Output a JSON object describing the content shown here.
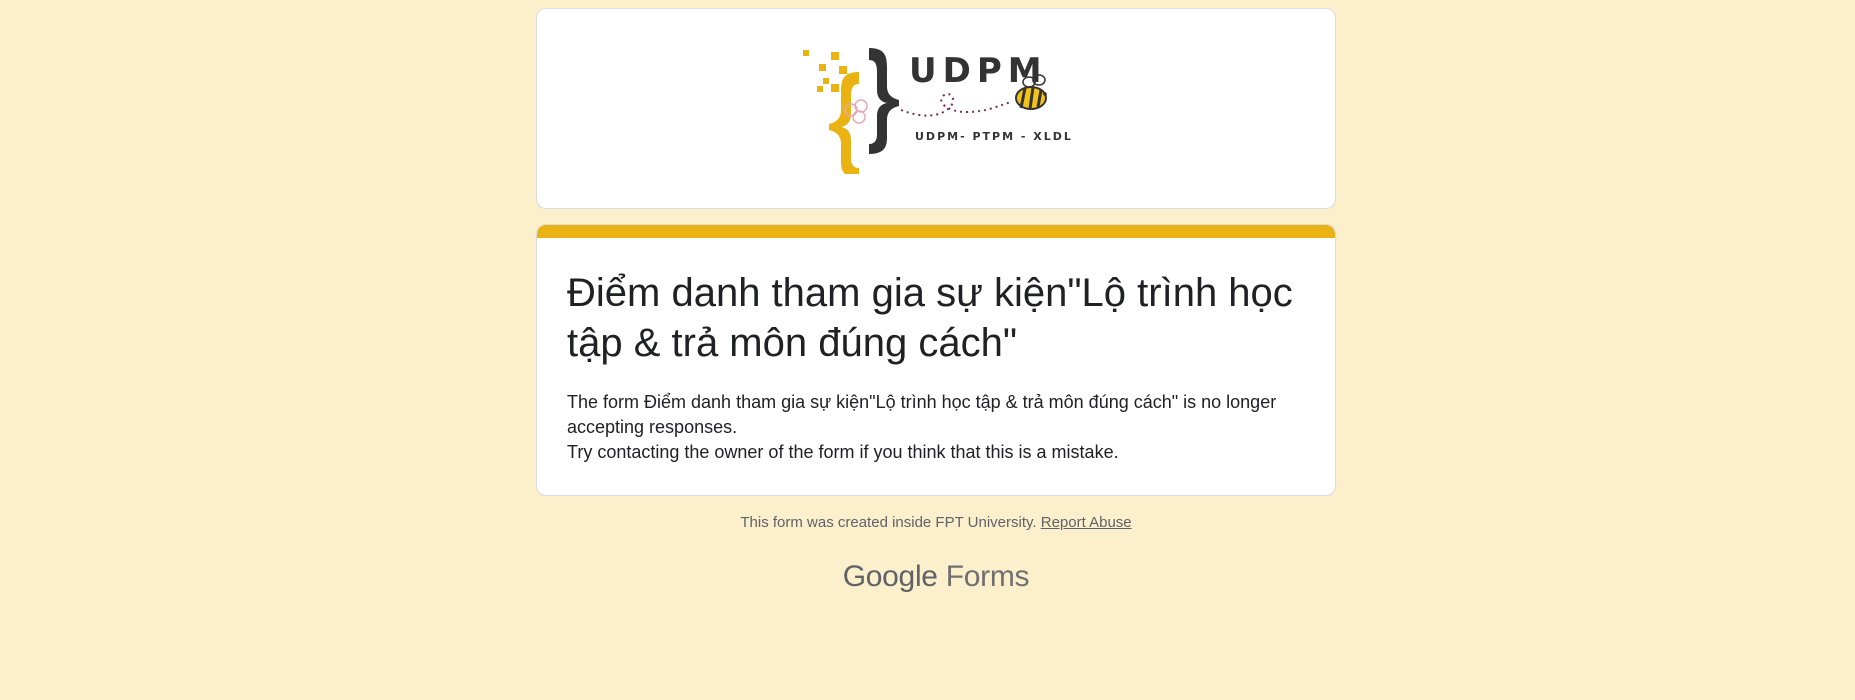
{
  "header": {
    "logo": {
      "name": "UDPM",
      "tagline": "UDPM- PTPM - XLDL",
      "icon": "bee-icon",
      "colors": {
        "yellow": "#ebb214",
        "dark": "#3c3c3c"
      }
    }
  },
  "main": {
    "title": "Điểm danh tham gia sự kiện\"Lộ trình học tập & trả môn đúng cách\"",
    "message_line1": "The form Điểm danh tham gia sự kiện\"Lộ trình học tập & trả môn đúng cách\" is no longer accepting responses.",
    "message_line2": "Try contacting the owner of the form if you think that this is a mistake.",
    "accent_color": "#ebb214"
  },
  "footer": {
    "created_text": "This form was created inside FPT University.",
    "report_link": "Report Abuse"
  },
  "brand": {
    "google": "Google",
    "forms": "Forms"
  },
  "colors": {
    "background": "#fcefcc",
    "card": "#ffffff"
  }
}
